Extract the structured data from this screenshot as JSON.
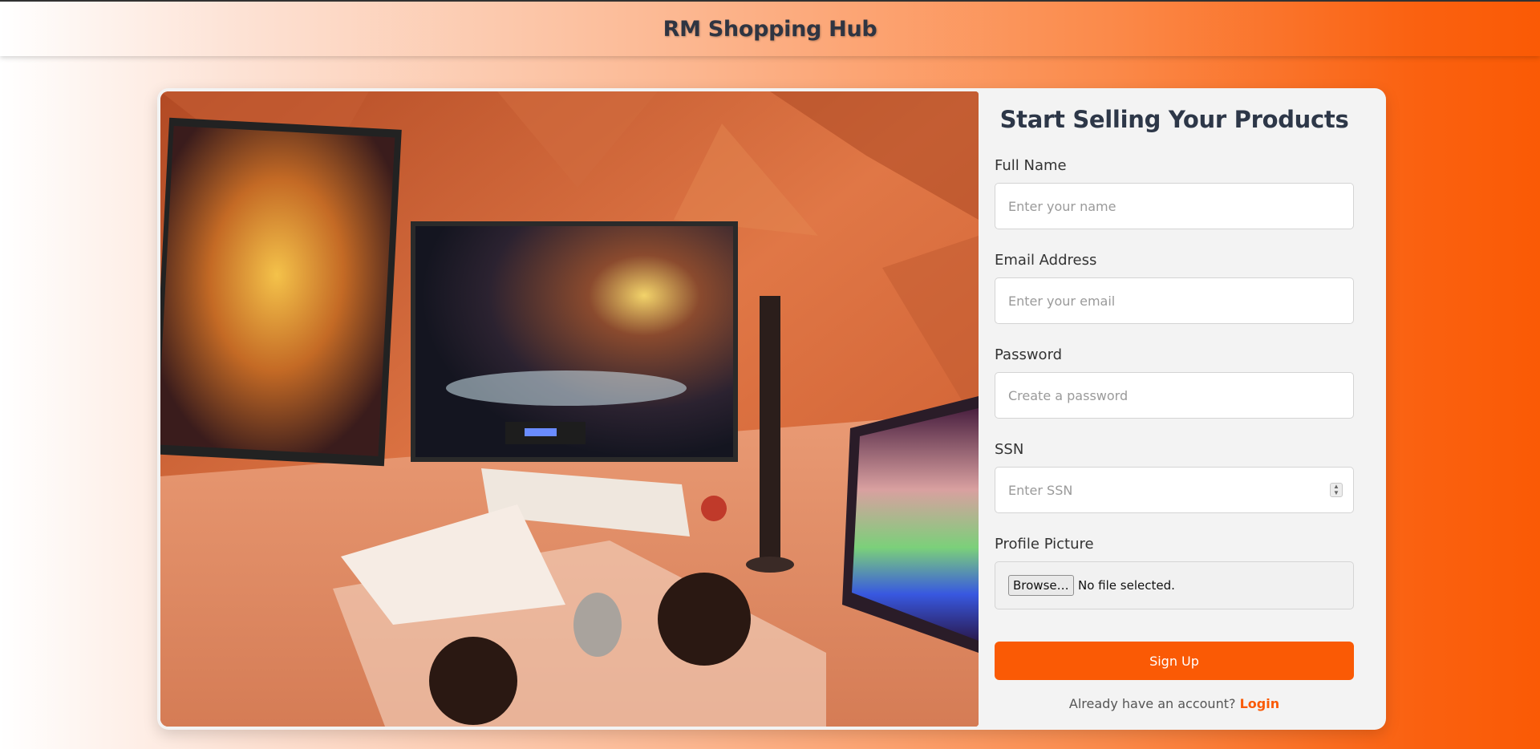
{
  "header": {
    "title": "RM Shopping Hub"
  },
  "form": {
    "heading": "Start Selling Your Products",
    "fields": [
      {
        "label": "Full Name",
        "placeholder": "Enter your name"
      },
      {
        "label": "Email Address",
        "placeholder": "Enter your email"
      },
      {
        "label": "Password",
        "placeholder": "Create a password"
      },
      {
        "label": "SSN",
        "placeholder": "Enter SSN"
      }
    ],
    "profile": {
      "label": "Profile Picture",
      "browse_label": "Browse…",
      "status": "No file selected."
    },
    "submit_label": "Sign Up",
    "footer_text": "Already have an account?",
    "login_label": "Login"
  },
  "colors": {
    "accent": "#fa5a05",
    "heading": "#2d3748"
  },
  "icons": {
    "ssn_spinner": "number-spinner-icon"
  }
}
